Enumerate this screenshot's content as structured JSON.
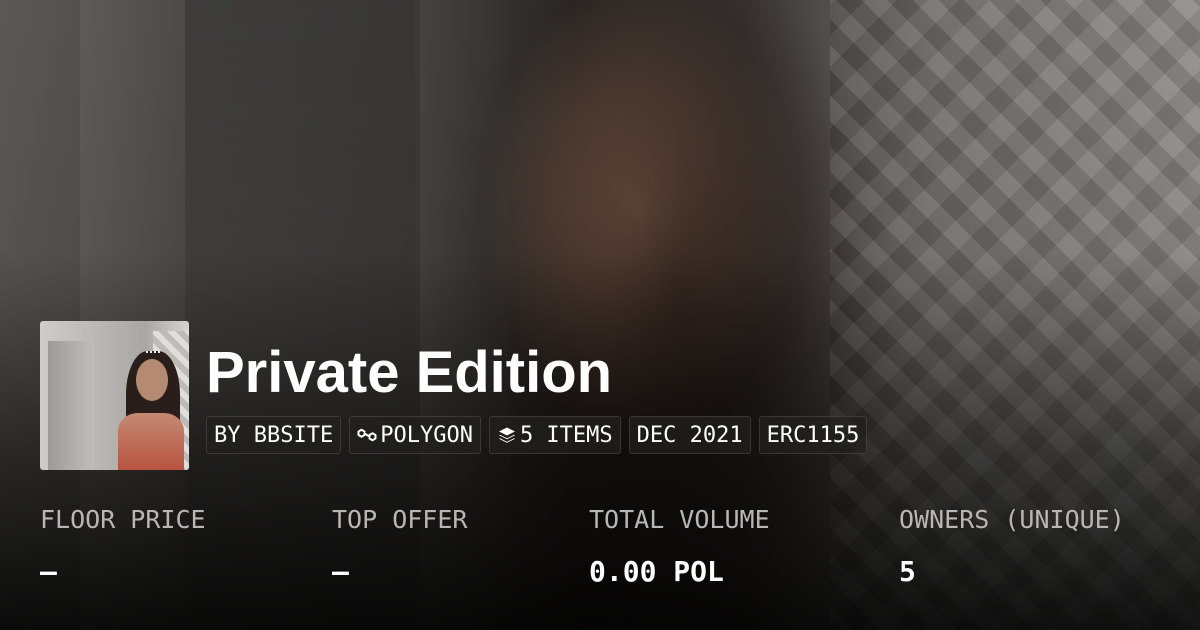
{
  "collection": {
    "title": "Private Edition"
  },
  "tags": [
    {
      "label": "BY BBSITE",
      "icon": ""
    },
    {
      "label": "POLYGON",
      "icon": "polygon-chain-icon"
    },
    {
      "label": "5 ITEMS",
      "icon": "layers-icon"
    },
    {
      "label": "DEC 2021",
      "icon": ""
    },
    {
      "label": "ERC1155",
      "icon": ""
    }
  ],
  "stats": [
    {
      "label": "FLOOR PRICE",
      "value": "–"
    },
    {
      "label": "TOP OFFER",
      "value": "–"
    },
    {
      "label": "TOTAL VOLUME",
      "value": "0.00 POL"
    },
    {
      "label": "OWNERS (UNIQUE)",
      "value": "5"
    }
  ]
}
